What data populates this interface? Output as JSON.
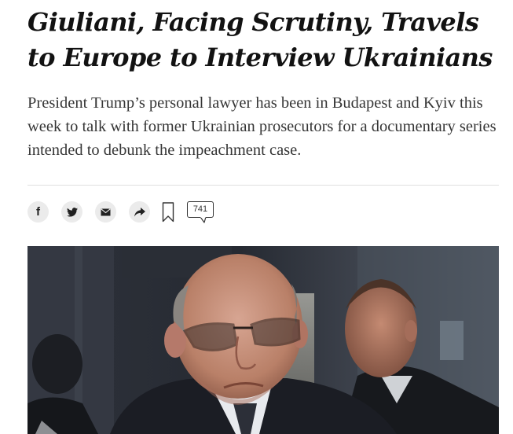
{
  "article": {
    "headline": "Giuliani, Facing Scrutiny, Travels to Europe to Interview Ukrainians",
    "summary": "President Trump’s personal lawyer has been in Budapest and Kyiv this week to talk with former Ukrainian prosecutors for a documentary series intended to debunk the impeachment case."
  },
  "share_tools": {
    "items": [
      {
        "name": "facebook-icon",
        "label": "f"
      },
      {
        "name": "twitter-icon"
      },
      {
        "name": "email-icon"
      },
      {
        "name": "share-icon"
      }
    ],
    "bookmark_icon": "bookmark-icon",
    "comment_count": "741"
  },
  "colors": {
    "headline": "#121212",
    "summary": "#363636",
    "share_button_bg": "#ebebeb",
    "divider": "#dfdfdf"
  }
}
